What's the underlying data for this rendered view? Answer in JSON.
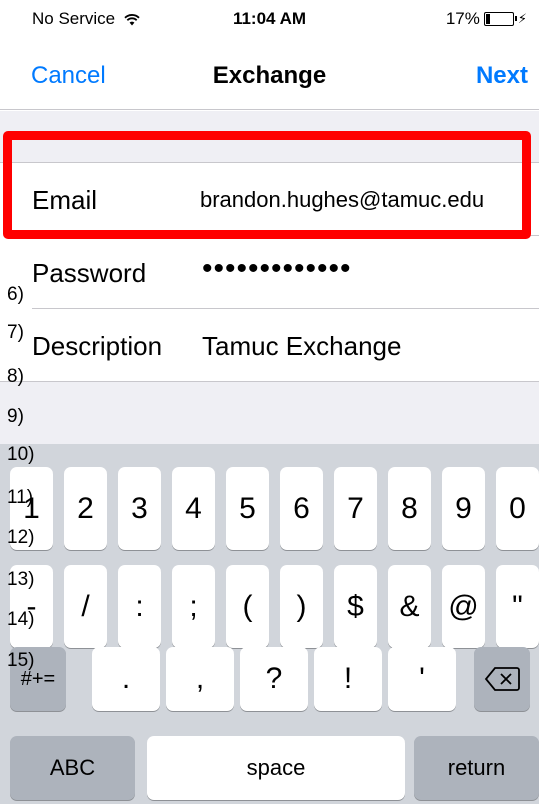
{
  "status_bar": {
    "carrier": "No Service",
    "time": "11:04 AM",
    "battery_percent_text": "17%",
    "battery_level": 0.17
  },
  "nav": {
    "cancel_label": "Cancel",
    "title": "Exchange",
    "next_label": "Next"
  },
  "form": {
    "email": {
      "label": "Email",
      "value": "brandon.hughes@tamuc.edu"
    },
    "password": {
      "label": "Password",
      "value": "•••••••••••••"
    },
    "description": {
      "label": "Description",
      "value": "Tamuc Exchange"
    }
  },
  "line_markers": [
    "6)",
    "7)",
    "8)",
    "9)",
    "10)",
    "11)",
    "12)",
    "13)",
    "14)",
    "15)"
  ],
  "keyboard": {
    "row1": [
      "1",
      "2",
      "3",
      "4",
      "5",
      "6",
      "7",
      "8",
      "9",
      "0"
    ],
    "row2": [
      "-",
      "/",
      ":",
      ";",
      "(",
      ")",
      "$",
      "&",
      "@",
      "\""
    ],
    "shift_label": "#+=",
    "row3": [
      ".",
      ",",
      "?",
      "!",
      "'"
    ],
    "abc_label": "ABC",
    "space_label": "space",
    "return_label": "return"
  },
  "colors": {
    "accent": "#007aff",
    "highlight": "#ff0000"
  },
  "icons": {
    "wifi": "wifi-icon",
    "charging": "lightning-bolt-icon",
    "backspace": "backspace-icon"
  }
}
